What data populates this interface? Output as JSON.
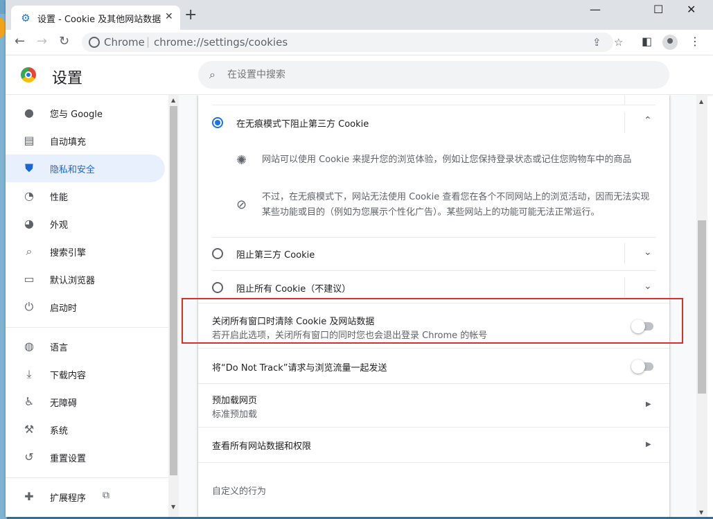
{
  "browser": {
    "tab_title": "设置 - Cookie 及其他网站数据",
    "tab_close": "✕",
    "new_tab": "+",
    "win_min": "—",
    "win_max": "☐",
    "win_close": "✕",
    "omnibox_origin": "Chrome",
    "omnibox_sep": "|",
    "omnibox_url": "chrome://settings/cookies"
  },
  "header": {
    "title": "设置",
    "search_placeholder": "在设置中搜索"
  },
  "sidebar": {
    "items": [
      {
        "label": "您与 Google",
        "icon": "person-icon"
      },
      {
        "label": "自动填充",
        "icon": "clipboard-icon"
      },
      {
        "label": "隐私和安全",
        "icon": "shield-icon",
        "active": true
      },
      {
        "label": "性能",
        "icon": "gauge-icon"
      },
      {
        "label": "外观",
        "icon": "palette-icon"
      },
      {
        "label": "搜索引擎",
        "icon": "search-icon"
      },
      {
        "label": "默认浏览器",
        "icon": "browser-icon"
      },
      {
        "label": "启动时",
        "icon": "power-icon"
      },
      {
        "label": "语言",
        "icon": "globe-icon"
      },
      {
        "label": "下载内容",
        "icon": "download-icon"
      },
      {
        "label": "无障碍",
        "icon": "accessibility-icon"
      },
      {
        "label": "系统",
        "icon": "wrench-icon"
      },
      {
        "label": "重置设置",
        "icon": "restore-icon"
      },
      {
        "label": "扩展程序",
        "icon": "puzzle-icon"
      }
    ]
  },
  "main": {
    "cookie_options": [
      {
        "label": "在无痕模式下阻止第三方 Cookie",
        "selected": true,
        "expanded": true
      },
      {
        "label": "阻止第三方 Cookie",
        "selected": false
      },
      {
        "label": "阻止所有 Cookie（不建议）",
        "selected": false
      }
    ],
    "details": [
      {
        "icon": "cookie-icon",
        "text": "网站可以使用 Cookie 来提升您的浏览体验，例如让您保持登录状态或记住您购物车中的商品"
      },
      {
        "icon": "block-icon",
        "text": "不过，在无痕模式下，网站无法使用 Cookie 查看您在各个不同网站上的浏览活动，因而无法实现某些功能或目的（例如为您展示个性化广告）。某些网站上的功能可能无法正常运行。"
      }
    ],
    "clear_on_exit": {
      "label": "关闭所有窗口时清除 Cookie 及网站数据",
      "sub": "若开启此选项，关闭所有窗口的同时您也会退出登录 Chrome 的帐号",
      "enabled": false
    },
    "do_not_track": {
      "label": "将“Do Not Track”请求与浏览流量一起发送",
      "enabled": false
    },
    "preload": {
      "label": "预加载网页",
      "sub": "标准预加载"
    },
    "site_data": {
      "label": "查看所有网站数据和权限"
    },
    "custom_behaviors_heading": "自定义的行为"
  },
  "colors": {
    "accent": "#1a73e8",
    "highlight_box": "#d93025"
  }
}
